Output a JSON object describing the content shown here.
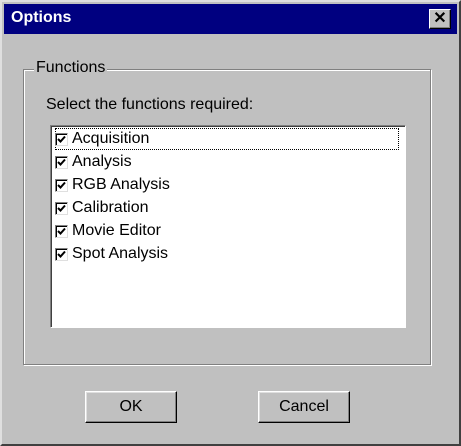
{
  "window": {
    "title": "Options",
    "close_label": "✕"
  },
  "group": {
    "legend": "Functions",
    "prompt": "Select the functions required:"
  },
  "functions": [
    {
      "label": "Acquisition",
      "checked": true
    },
    {
      "label": "Analysis",
      "checked": true
    },
    {
      "label": "RGB Analysis",
      "checked": true
    },
    {
      "label": "Calibration",
      "checked": true
    },
    {
      "label": "Movie Editor",
      "checked": true
    },
    {
      "label": "Spot Analysis",
      "checked": true
    }
  ],
  "buttons": {
    "ok": "OK",
    "cancel": "Cancel"
  },
  "colors": {
    "titlebar": "#000080",
    "face": "#c0c0c0"
  }
}
